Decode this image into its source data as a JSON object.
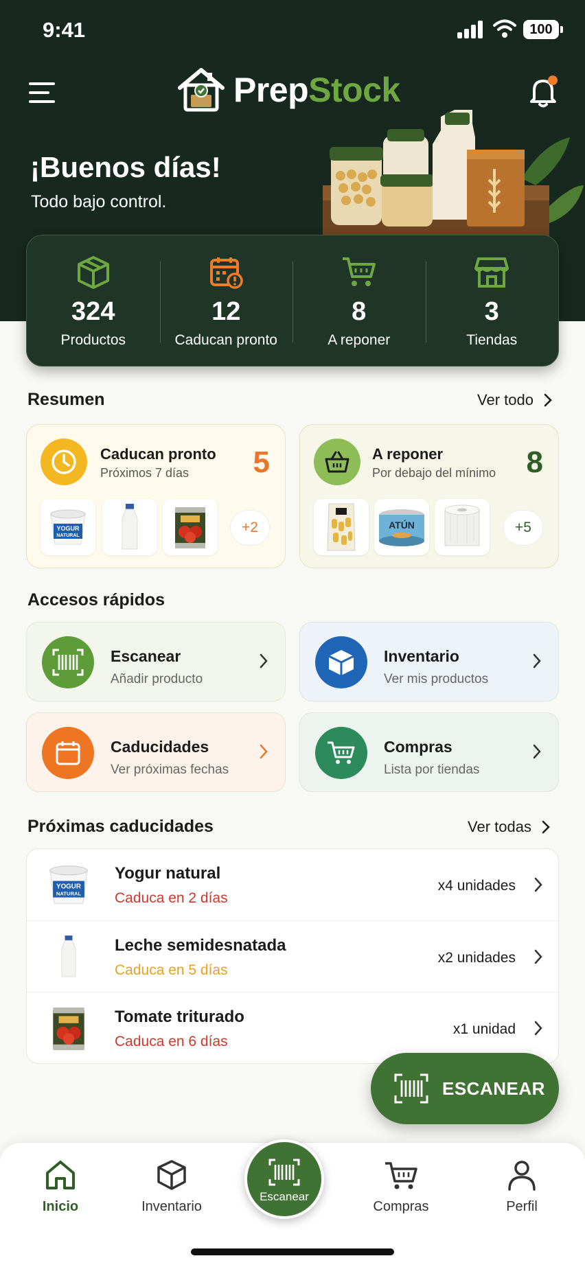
{
  "status_bar": {
    "time": "9:41",
    "battery": "100"
  },
  "header": {
    "brand_prep": "Prep",
    "brand_stock": "Stock",
    "greeting": "¡Buenos días!",
    "subgreeting": "Todo bajo control."
  },
  "stats": [
    {
      "value": "324",
      "label": "Productos",
      "icon": "box-icon"
    },
    {
      "value": "12",
      "label": "Caducan pronto",
      "icon": "calendar-alert-icon"
    },
    {
      "value": "8",
      "label": "A reponer",
      "icon": "cart-icon"
    },
    {
      "value": "3",
      "label": "Tiendas",
      "icon": "store-icon"
    }
  ],
  "resumen": {
    "title": "Resumen",
    "link": "Ver todo",
    "cards": [
      {
        "title": "Caducan pronto",
        "subtitle": "Próximos 7 días",
        "count": "5",
        "more": "+2",
        "color": "#e8772c"
      },
      {
        "title": "A reponer",
        "subtitle": "Por debajo del mínimo",
        "count": "8",
        "more": "+5",
        "color": "#2f5e26"
      }
    ],
    "thumb_texts": {
      "yogur_1": "YOGUR",
      "yogur_2": "NATURAL",
      "atun": "ATÚN"
    }
  },
  "quick": {
    "title": "Accesos rápidos",
    "items": [
      {
        "title": "Escanear",
        "subtitle": "Añadir producto"
      },
      {
        "title": "Inventario",
        "subtitle": "Ver mis productos"
      },
      {
        "title": "Caducidades",
        "subtitle": "Ver próximas fechas"
      },
      {
        "title": "Compras",
        "subtitle": "Lista por tiendas"
      }
    ]
  },
  "expiring": {
    "title": "Próximas caducidades",
    "link": "Ver todas",
    "items": [
      {
        "name": "Yogur natural",
        "when": "Caduca en 2 días",
        "qty": "x4 unidades",
        "color": "#d2372b"
      },
      {
        "name": "Leche semidesnatada",
        "when": "Caduca en 5 días",
        "qty": "x2 unidades",
        "color": "#e8a21c"
      },
      {
        "name": "Tomate triturado",
        "when": "Caduca en 6 días",
        "qty": "x1 unidad",
        "color": "#d2372b"
      }
    ]
  },
  "fab": {
    "label": "ESCANEAR"
  },
  "nav": {
    "inicio": "Inicio",
    "inventario": "Inventario",
    "escanear": "Escanear",
    "compras": "Compras",
    "perfil": "Perfil"
  },
  "colors": {
    "header_bg": "#17281e",
    "brand_green": "#6fa840",
    "accent_green": "#3f7233",
    "orange": "#f07c27"
  }
}
